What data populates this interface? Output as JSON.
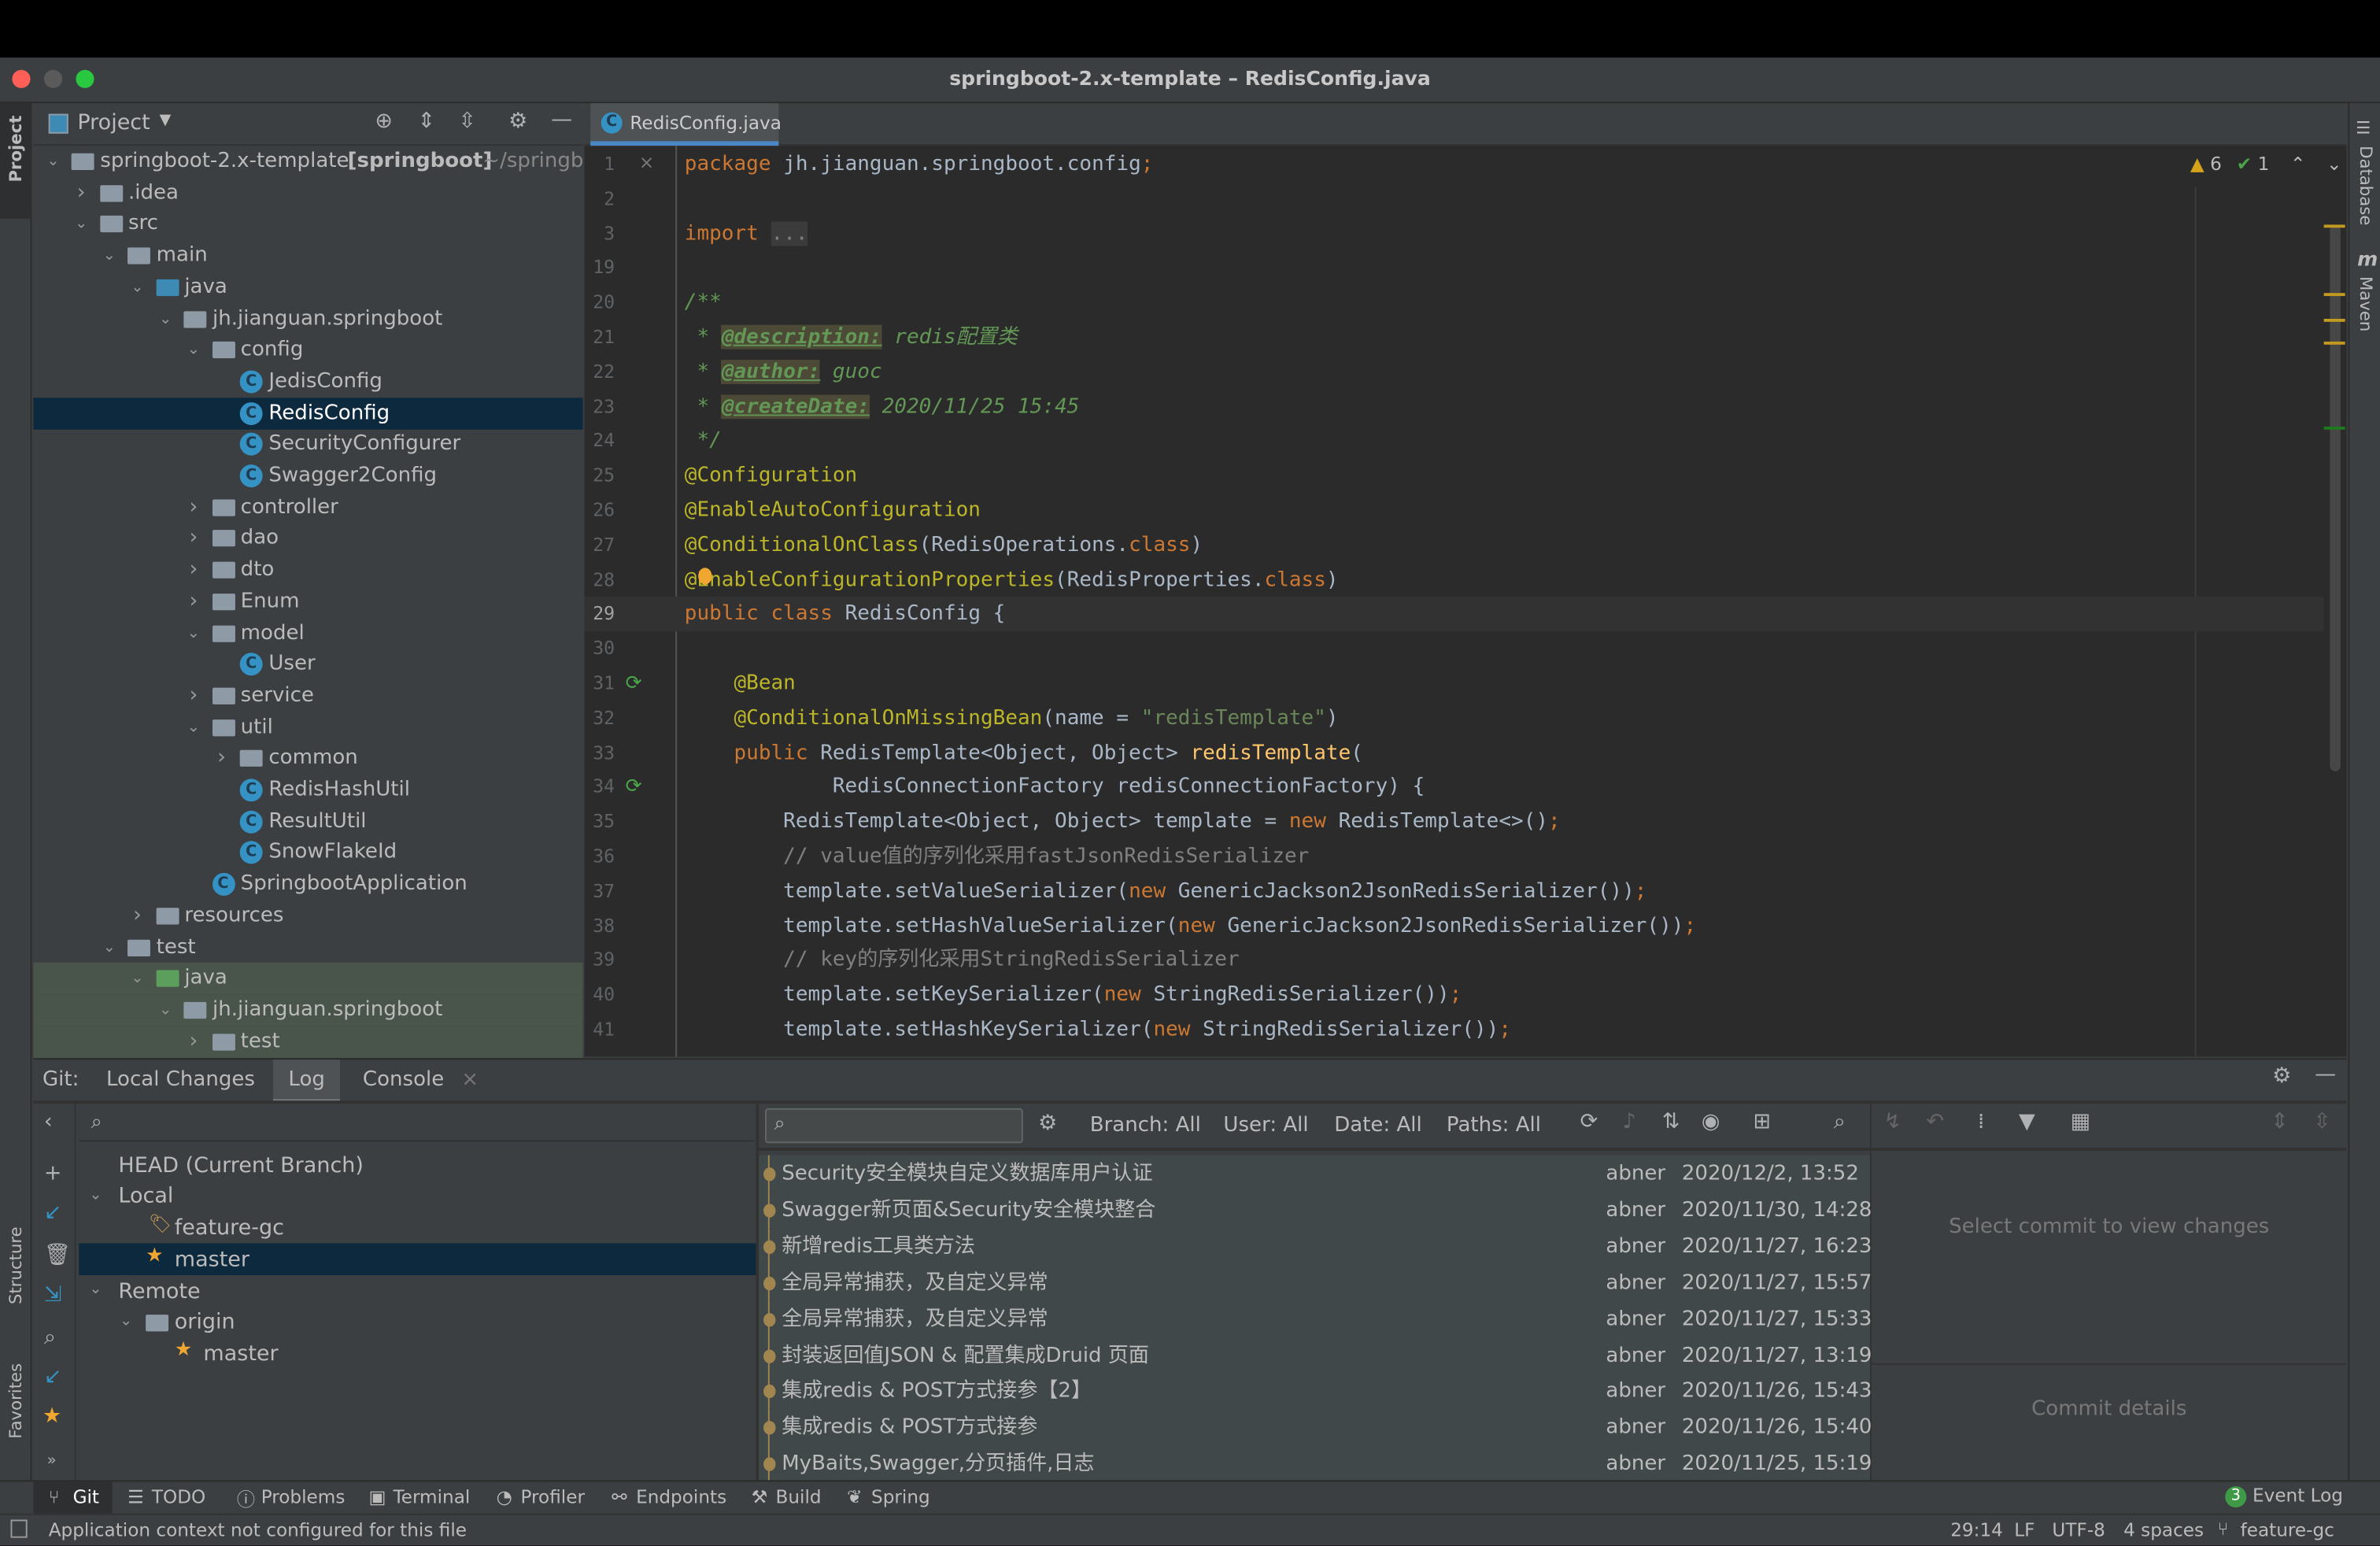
{
  "window": {
    "title": "springboot-2.x-template – RedisConfig.java",
    "traffic_colors": [
      "#ff5f57",
      "#febc2e",
      "#28c840"
    ]
  },
  "left_strip": {
    "project": "Project",
    "structure": "Structure",
    "favorites": "Favorites"
  },
  "right_strip": {
    "database": "Database",
    "maven": "Maven"
  },
  "project_panel": {
    "title": "Project",
    "tree": [
      {
        "depth": 0,
        "type": "module",
        "open": true,
        "label": "springboot-2.x-template",
        "bold": "[springboot]",
        "hint": "~/springboot"
      },
      {
        "depth": 1,
        "type": "folder",
        "open": false,
        "label": ".idea"
      },
      {
        "depth": 1,
        "type": "folder",
        "open": true,
        "label": "src"
      },
      {
        "depth": 2,
        "type": "folder",
        "open": true,
        "label": "main"
      },
      {
        "depth": 3,
        "type": "srcfolder",
        "open": true,
        "label": "java"
      },
      {
        "depth": 4,
        "type": "package",
        "open": true,
        "label": "jh.jianguan.springboot"
      },
      {
        "depth": 5,
        "type": "package",
        "open": true,
        "label": "config"
      },
      {
        "depth": 6,
        "type": "class",
        "label": "JedisConfig"
      },
      {
        "depth": 6,
        "type": "class",
        "label": "RedisConfig",
        "selected": true
      },
      {
        "depth": 6,
        "type": "class",
        "label": "SecurityConfigurer"
      },
      {
        "depth": 6,
        "type": "class",
        "label": "Swagger2Config"
      },
      {
        "depth": 5,
        "type": "package",
        "open": false,
        "label": "controller"
      },
      {
        "depth": 5,
        "type": "package",
        "open": false,
        "label": "dao"
      },
      {
        "depth": 5,
        "type": "package",
        "open": false,
        "label": "dto"
      },
      {
        "depth": 5,
        "type": "package",
        "open": false,
        "label": "Enum"
      },
      {
        "depth": 5,
        "type": "package",
        "open": true,
        "label": "model"
      },
      {
        "depth": 6,
        "type": "class",
        "label": "User"
      },
      {
        "depth": 5,
        "type": "package",
        "open": false,
        "label": "service"
      },
      {
        "depth": 5,
        "type": "package",
        "open": true,
        "label": "util"
      },
      {
        "depth": 6,
        "type": "package",
        "open": false,
        "label": "common"
      },
      {
        "depth": 6,
        "type": "class",
        "label": "RedisHashUtil"
      },
      {
        "depth": 6,
        "type": "class",
        "label": "ResultUtil"
      },
      {
        "depth": 6,
        "type": "class",
        "label": "SnowFlakeId"
      },
      {
        "depth": 5,
        "type": "class",
        "label": "SpringbootApplication"
      },
      {
        "depth": 3,
        "type": "folder",
        "open": false,
        "label": "resources"
      },
      {
        "depth": 2,
        "type": "folder",
        "open": true,
        "label": "test"
      },
      {
        "depth": 3,
        "type": "srcfolder",
        "open": true,
        "label": "java",
        "green": true
      },
      {
        "depth": 4,
        "type": "package",
        "open": true,
        "label": "jh.jianguan.springboot",
        "green": true
      },
      {
        "depth": 5,
        "type": "package",
        "open": false,
        "label": "test",
        "green": true
      }
    ]
  },
  "editor": {
    "tab": "RedisConfig.java",
    "inspections": {
      "warnings": "6",
      "ok": "1"
    },
    "current_line": "29",
    "lines": [
      {
        "n": "1",
        "t": [
          [
            "package ",
            "kw"
          ],
          [
            "jh.jianguan.springboot.config",
            "pl"
          ],
          [
            ";",
            "kw"
          ]
        ]
      },
      {
        "n": "2",
        "t": []
      },
      {
        "n": "3",
        "t": [
          [
            "import ",
            "kw"
          ],
          [
            "...",
            "fold"
          ]
        ]
      },
      {
        "n": "19",
        "t": []
      },
      {
        "n": "20",
        "t": [
          [
            "/**",
            "dc"
          ]
        ]
      },
      {
        "n": "21",
        "t": [
          [
            " * ",
            "dc"
          ],
          [
            "@description:",
            "dt"
          ],
          [
            " redis配置类",
            "dc"
          ]
        ]
      },
      {
        "n": "22",
        "t": [
          [
            " * ",
            "dc"
          ],
          [
            "@author:",
            "dt"
          ],
          [
            " guoc",
            "dc"
          ]
        ]
      },
      {
        "n": "23",
        "t": [
          [
            " * ",
            "dc"
          ],
          [
            "@createDate:",
            "dt"
          ],
          [
            " 2020/11/25 15:45",
            "dc"
          ]
        ]
      },
      {
        "n": "24",
        "t": [
          [
            " */",
            "dc"
          ]
        ]
      },
      {
        "n": "25",
        "t": [
          [
            "@Configuration",
            "an"
          ]
        ]
      },
      {
        "n": "26",
        "t": [
          [
            "@EnableAutoConfiguration",
            "an"
          ]
        ]
      },
      {
        "n": "27",
        "t": [
          [
            "@ConditionalOnClass",
            "an"
          ],
          [
            "(RedisOperations.",
            "pl"
          ],
          [
            "class",
            "kw"
          ],
          [
            ")",
            "pl"
          ]
        ]
      },
      {
        "n": "28",
        "t": [
          [
            "@EnableConfigurationProperties",
            "an"
          ],
          [
            "(RedisProperties.",
            "pl"
          ],
          [
            "class",
            "kw"
          ],
          [
            ")",
            "pl"
          ]
        ]
      },
      {
        "n": "29",
        "t": [
          [
            "public class ",
            "kw"
          ],
          [
            "RedisConfig {",
            "pl"
          ]
        ]
      },
      {
        "n": "30",
        "t": []
      },
      {
        "n": "31",
        "t": [
          [
            "    @Bean",
            "an"
          ]
        ]
      },
      {
        "n": "32",
        "t": [
          [
            "    @ConditionalOnMissingBean",
            "an"
          ],
          [
            "(name = ",
            "pl"
          ],
          [
            "\"redisTemplate\"",
            "st"
          ],
          [
            ")",
            "pl"
          ]
        ]
      },
      {
        "n": "33",
        "t": [
          [
            "    public ",
            "kw"
          ],
          [
            "RedisTemplate<Object, Object> ",
            "pl"
          ],
          [
            "redisTemplate",
            "fn"
          ],
          [
            "(",
            "pl"
          ]
        ]
      },
      {
        "n": "34",
        "t": [
          [
            "            RedisConnectionFactory redisConnectionFactory) {",
            "pl"
          ]
        ]
      },
      {
        "n": "35",
        "t": [
          [
            "        RedisTemplate<Object, Object> template = ",
            "pl"
          ],
          [
            "new ",
            "kw"
          ],
          [
            "RedisTemplate<>()",
            "pl"
          ],
          [
            ";",
            "kw"
          ]
        ]
      },
      {
        "n": "36",
        "t": [
          [
            "        // value值的序列化采用fastJsonRedisSerializer",
            "cm"
          ]
        ]
      },
      {
        "n": "37",
        "t": [
          [
            "        template.setValueSerializer(",
            "pl"
          ],
          [
            "new ",
            "kw"
          ],
          [
            "GenericJackson2JsonRedisSerializer())",
            "pl"
          ],
          [
            ";",
            "kw"
          ]
        ]
      },
      {
        "n": "38",
        "t": [
          [
            "        template.setHashValueSerializer(",
            "pl"
          ],
          [
            "new ",
            "kw"
          ],
          [
            "GenericJackson2JsonRedisSerializer())",
            "pl"
          ],
          [
            ";",
            "kw"
          ]
        ]
      },
      {
        "n": "39",
        "t": [
          [
            "        // key的序列化采用StringRedisSerializer",
            "cm"
          ]
        ]
      },
      {
        "n": "40",
        "t": [
          [
            "        template.setKeySerializer(",
            "pl"
          ],
          [
            "new ",
            "kw"
          ],
          [
            "StringRedisSerializer())",
            "pl"
          ],
          [
            ";",
            "kw"
          ]
        ]
      },
      {
        "n": "41",
        "t": [
          [
            "        template.setHashKeySerializer(",
            "pl"
          ],
          [
            "new ",
            "kw"
          ],
          [
            "StringRedisSerializer())",
            "pl"
          ],
          [
            ";",
            "kw"
          ]
        ]
      }
    ]
  },
  "git": {
    "label": "Git:",
    "tabs": [
      "Local Changes",
      "Log",
      "Console"
    ],
    "active_tab": "Log",
    "filters": {
      "branch": "Branch: All",
      "user": "User: All",
      "date": "Date: All",
      "paths": "Paths: All"
    },
    "branches": {
      "head": "HEAD (Current Branch)",
      "local": "Local",
      "local_items": [
        "feature-gc",
        "master"
      ],
      "remote": "Remote",
      "origin": "origin",
      "remote_items": [
        "master"
      ]
    },
    "commits": [
      {
        "msg": "Security安全模块自定义数据库用户认证",
        "author": "abner",
        "date": "2020/12/2, 13:52"
      },
      {
        "msg": "Swagger新页面&Security安全模块整合",
        "author": "abner",
        "date": "2020/11/30, 14:28"
      },
      {
        "msg": "新增redis工具类方法",
        "author": "abner",
        "date": "2020/11/27, 16:23"
      },
      {
        "msg": "全局异常捕获，及自定义异常",
        "author": "abner",
        "date": "2020/11/27, 15:57"
      },
      {
        "msg": "全局异常捕获，及自定义异常",
        "author": "abner",
        "date": "2020/11/27, 15:33"
      },
      {
        "msg": "封装返回值JSON & 配置集成Druid 页面",
        "author": "abner",
        "date": "2020/11/27, 13:19"
      },
      {
        "msg": "集成redis & POST方式接参【2】",
        "author": "abner",
        "date": "2020/11/26, 15:43"
      },
      {
        "msg": "集成redis & POST方式接参",
        "author": "abner",
        "date": "2020/11/26, 15:40"
      },
      {
        "msg": "MyBaits,Swagger,分页插件,日志",
        "author": "abner",
        "date": "2020/11/25, 15:19"
      }
    ],
    "select_hint": "Select commit to view changes",
    "details_hint": "Commit details"
  },
  "bottom_tools": [
    "Git",
    "TODO",
    "Problems",
    "Terminal",
    "Profiler",
    "Endpoints",
    "Build",
    "Spring"
  ],
  "event_log": {
    "count": "3",
    "label": "Event Log"
  },
  "status": {
    "message": "Application context not configured for this file",
    "position": "29:14",
    "line_sep": "LF",
    "encoding": "UTF-8",
    "indent": "4 spaces",
    "branch": "feature-gc"
  }
}
